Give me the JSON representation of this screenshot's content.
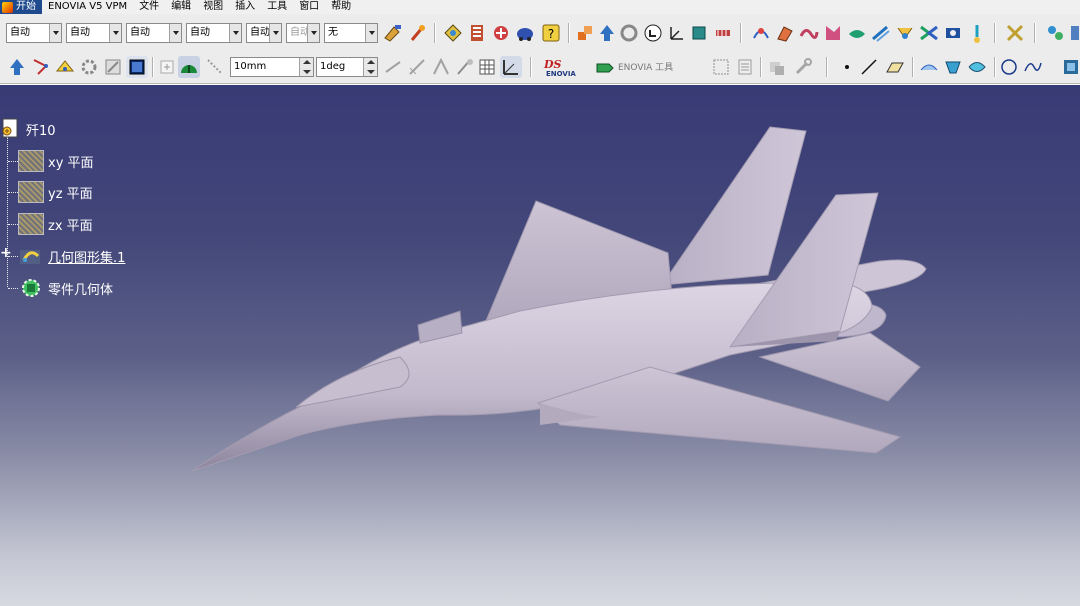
{
  "menu": {
    "start": "开始",
    "items": [
      "ENOVIA V5 VPM",
      "文件",
      "编辑",
      "视图",
      "插入",
      "工具",
      "窗口",
      "帮助"
    ]
  },
  "toolbar": {
    "combos": [
      "自动",
      "自动",
      "自动",
      "自动",
      "自动",
      "自动",
      "无"
    ],
    "spin_length": "10mm",
    "spin_angle": "1deg",
    "enovia_label": "ENOVIA 工具"
  },
  "icons": [
    "color-icon",
    "paint-icon",
    "sketch-icon",
    "knowledge-icon",
    "formula-icon",
    "catalog-icon",
    "help-icon",
    "tools-icon",
    "axis-icon",
    "render-icon",
    "rotate-icon",
    "point-icon",
    "line-icon",
    "plane-icon",
    "surface-icon",
    "sweep-icon",
    "fill-icon",
    "blend-icon",
    "extrude-icon",
    "offset-icon",
    "join-icon",
    "split-icon",
    "measure-icon",
    "circle-icon",
    "spline-icon"
  ],
  "tree": {
    "root": "歼10",
    "items": [
      "xy 平面",
      "yz 平面",
      "zx 平面",
      "几何图形集.1",
      "零件几何体"
    ]
  },
  "colors": {
    "viewport_top": "#383b75",
    "viewport_bottom": "#d7d9e1",
    "model": "#c8bfd1",
    "model_shadow": "#9c94ab"
  }
}
